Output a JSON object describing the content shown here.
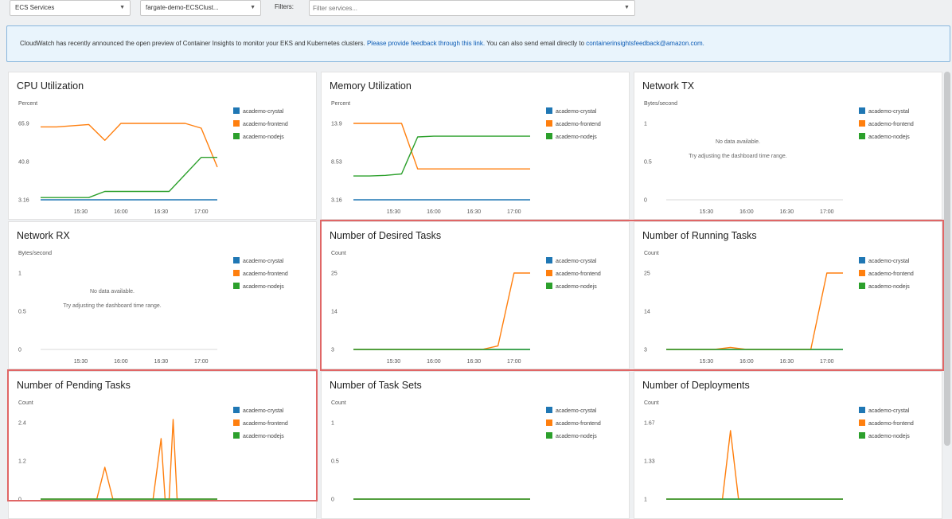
{
  "toolbar": {
    "service_dropdown": "ECS Services",
    "cluster_dropdown": "fargate-demo-ECSClust...",
    "filters_label": "Filters:",
    "filters_placeholder": "Filter services..."
  },
  "banner": {
    "text_pre": "CloudWatch has recently announced the open preview of Container Insights to monitor your EKS and Kubernetes clusters. ",
    "feedback_link": "Please provide feedback through this link.",
    "text_mid": " You can also send email directly to ",
    "email_link": "containerinsightsfeedback@amazon.com."
  },
  "colors": {
    "crystal": "#1f77b4",
    "frontend": "#ff7f0e",
    "nodejs": "#2ca02c",
    "highlight": "#e06666"
  },
  "highlighted_panels": [
    "Number of Desired Tasks",
    "Number of Running Tasks",
    "Number of Pending Tasks"
  ],
  "chart_data": [
    {
      "type": "line",
      "title": "CPU Utilization",
      "ylabel": "Percent",
      "y_ticks": [
        "65.9",
        "40.8",
        "3.16"
      ],
      "ylim": [
        3.16,
        65.9
      ],
      "x_ticks": [
        "15:30",
        "16:00",
        "16:30",
        "17:00"
      ],
      "x": [
        15.0,
        15.2,
        15.4,
        15.6,
        15.8,
        16.0,
        16.2,
        16.4,
        16.6,
        16.8,
        17.0,
        17.2
      ],
      "series": [
        {
          "name": "academo-crystal",
          "values": [
            3.16,
            3.16,
            3.16,
            3.16,
            3.16,
            3.16,
            3.16,
            3.16,
            3.16,
            3.16,
            3.16,
            3.16
          ]
        },
        {
          "name": "academo-frontend",
          "values": [
            63,
            63,
            64,
            65,
            52,
            65.9,
            65.9,
            65.9,
            65.9,
            65.9,
            62,
            30
          ]
        },
        {
          "name": "academo-nodejs",
          "values": [
            5,
            5,
            5,
            5,
            10,
            10,
            10,
            10,
            10,
            24,
            38,
            38
          ]
        }
      ]
    },
    {
      "type": "line",
      "title": "Memory Utilization",
      "ylabel": "Percent",
      "y_ticks": [
        "13.9",
        "8.53",
        "3.16"
      ],
      "ylim": [
        3.16,
        13.9
      ],
      "x_ticks": [
        "15:30",
        "16:00",
        "16:30",
        "17:00"
      ],
      "x": [
        15.0,
        15.2,
        15.4,
        15.6,
        15.8,
        16.0,
        16.2,
        16.4,
        16.6,
        16.8,
        17.0,
        17.2
      ],
      "series": [
        {
          "name": "academo-crystal",
          "values": [
            3.16,
            3.16,
            3.16,
            3.16,
            3.16,
            3.16,
            3.16,
            3.16,
            3.16,
            3.16,
            3.16,
            3.16
          ]
        },
        {
          "name": "academo-frontend",
          "values": [
            13.9,
            13.9,
            13.9,
            13.9,
            7.5,
            7.5,
            7.5,
            7.5,
            7.5,
            7.5,
            7.5,
            7.5
          ]
        },
        {
          "name": "academo-nodejs",
          "values": [
            6.5,
            6.5,
            6.6,
            6.8,
            12.0,
            12.1,
            12.1,
            12.1,
            12.1,
            12.1,
            12.1,
            12.1
          ]
        }
      ]
    },
    {
      "type": "line",
      "title": "Network TX",
      "ylabel": "Bytes/second",
      "y_ticks": [
        "1",
        "0.5",
        "0"
      ],
      "ylim": [
        0,
        1
      ],
      "x_ticks": [
        "15:30",
        "16:00",
        "16:30",
        "17:00"
      ],
      "x": [],
      "series": [
        {
          "name": "academo-crystal",
          "values": []
        },
        {
          "name": "academo-frontend",
          "values": []
        },
        {
          "name": "academo-nodejs",
          "values": []
        }
      ],
      "no_data": "No data available.",
      "no_data_hint": "Try adjusting the dashboard time range."
    },
    {
      "type": "line",
      "title": "Network RX",
      "ylabel": "Bytes/second",
      "y_ticks": [
        "1",
        "0.5",
        "0"
      ],
      "ylim": [
        0,
        1
      ],
      "x_ticks": [
        "15:30",
        "16:00",
        "16:30",
        "17:00"
      ],
      "x": [],
      "series": [
        {
          "name": "academo-crystal",
          "values": []
        },
        {
          "name": "academo-frontend",
          "values": []
        },
        {
          "name": "academo-nodejs",
          "values": []
        }
      ],
      "no_data": "No data available.",
      "no_data_hint": "Try adjusting the dashboard time range."
    },
    {
      "type": "line",
      "title": "Number of Desired Tasks",
      "ylabel": "Count",
      "y_ticks": [
        "25",
        "14",
        "3"
      ],
      "ylim": [
        3,
        25
      ],
      "x_ticks": [
        "15:30",
        "16:00",
        "16:30",
        "17:00"
      ],
      "x": [
        15.0,
        15.2,
        15.4,
        15.6,
        15.8,
        16.0,
        16.2,
        16.4,
        16.6,
        16.8,
        17.0,
        17.2
      ],
      "series": [
        {
          "name": "academo-crystal",
          "values": [
            3,
            3,
            3,
            3,
            3,
            3,
            3,
            3,
            3,
            3,
            3,
            3
          ]
        },
        {
          "name": "academo-frontend",
          "values": [
            3,
            3,
            3,
            3,
            3,
            3,
            3,
            3,
            3,
            4,
            25,
            25
          ]
        },
        {
          "name": "academo-nodejs",
          "values": [
            3,
            3,
            3,
            3,
            3,
            3,
            3,
            3,
            3,
            3,
            3,
            3
          ]
        }
      ]
    },
    {
      "type": "line",
      "title": "Number of Running Tasks",
      "ylabel": "Count",
      "y_ticks": [
        "25",
        "14",
        "3"
      ],
      "ylim": [
        3,
        25
      ],
      "x_ticks": [
        "15:30",
        "16:00",
        "16:30",
        "17:00"
      ],
      "x": [
        15.0,
        15.2,
        15.4,
        15.6,
        15.8,
        16.0,
        16.2,
        16.4,
        16.6,
        16.8,
        17.0,
        17.2
      ],
      "series": [
        {
          "name": "academo-crystal",
          "values": [
            3,
            3,
            3,
            3,
            3,
            3,
            3,
            3,
            3,
            3,
            3,
            3
          ]
        },
        {
          "name": "academo-frontend",
          "values": [
            3,
            3,
            3,
            3,
            3.6,
            3,
            3,
            3,
            3,
            3,
            25,
            25
          ]
        },
        {
          "name": "academo-nodejs",
          "values": [
            3,
            3,
            3,
            3,
            3,
            3,
            3,
            3,
            3,
            3,
            3,
            3
          ]
        }
      ]
    },
    {
      "type": "line",
      "title": "Number of Pending Tasks",
      "ylabel": "Count",
      "y_ticks": [
        "2.4",
        "1.2",
        "0"
      ],
      "ylim": [
        0,
        2.4
      ],
      "x_ticks": [],
      "x": [
        15.0,
        15.2,
        15.4,
        15.6,
        15.7,
        15.8,
        15.9,
        16.0,
        16.2,
        16.3,
        16.4,
        16.5,
        16.55,
        16.6,
        16.65,
        16.7,
        16.8,
        17.0,
        17.2
      ],
      "series": [
        {
          "name": "academo-crystal",
          "values": [
            0,
            0,
            0,
            0,
            0,
            0,
            0,
            0,
            0,
            0,
            0,
            0,
            0,
            0,
            0,
            0,
            0,
            0,
            0
          ]
        },
        {
          "name": "academo-frontend",
          "values": [
            0,
            0,
            0,
            0,
            0,
            1.0,
            0,
            0,
            0,
            0,
            0,
            1.9,
            0,
            0,
            2.5,
            0,
            0,
            0,
            0
          ]
        },
        {
          "name": "academo-nodejs",
          "values": [
            0,
            0,
            0,
            0,
            0,
            0,
            0,
            0,
            0,
            0,
            0,
            0,
            0,
            0,
            0,
            0,
            0,
            0,
            0
          ]
        }
      ]
    },
    {
      "type": "line",
      "title": "Number of Task Sets",
      "ylabel": "Count",
      "y_ticks": [
        "1",
        "0.5",
        "0"
      ],
      "ylim": [
        0,
        1
      ],
      "x_ticks": [],
      "x": [
        15.0,
        15.6,
        16.2,
        16.8,
        17.2
      ],
      "series": [
        {
          "name": "academo-crystal",
          "values": [
            0,
            0,
            0,
            0,
            0
          ]
        },
        {
          "name": "academo-frontend",
          "values": [
            0,
            0,
            0,
            0,
            0
          ]
        },
        {
          "name": "academo-nodejs",
          "values": [
            0,
            0,
            0,
            0,
            0
          ]
        }
      ]
    },
    {
      "type": "line",
      "title": "Number of Deployments",
      "ylabel": "Count",
      "y_ticks": [
        "1.67",
        "1.33",
        "1"
      ],
      "ylim": [
        1,
        1.67
      ],
      "x_ticks": [],
      "x": [
        15.0,
        15.2,
        15.4,
        15.6,
        15.7,
        15.8,
        15.9,
        16.0,
        16.2,
        16.4,
        16.6,
        16.8,
        17.0,
        17.2
      ],
      "series": [
        {
          "name": "academo-crystal",
          "values": [
            1,
            1,
            1,
            1,
            1,
            1,
            1,
            1,
            1,
            1,
            1,
            1,
            1,
            1
          ]
        },
        {
          "name": "academo-frontend",
          "values": [
            1,
            1,
            1,
            1,
            1,
            1.6,
            1,
            1,
            1,
            1,
            1,
            1,
            1,
            1
          ]
        },
        {
          "name": "academo-nodejs",
          "values": [
            1,
            1,
            1,
            1,
            1,
            1,
            1,
            1,
            1,
            1,
            1,
            1,
            1,
            1
          ]
        }
      ]
    }
  ]
}
